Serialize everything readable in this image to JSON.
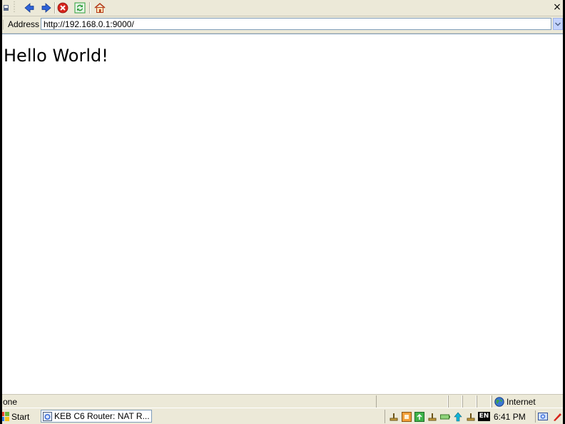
{
  "toolbar": {
    "icons": [
      "back-icon",
      "forward-icon",
      "stop-icon",
      "refresh-icon",
      "home-icon"
    ],
    "close_label": "×"
  },
  "address": {
    "label": "Address",
    "url": "http://192.168.0.1:9000/"
  },
  "content": {
    "heading": "Hello World!"
  },
  "statusbar": {
    "text": "one",
    "zone": "Internet"
  },
  "taskbar": {
    "start_label": "Start",
    "window_title": "KEB C6 Router: NAT R...",
    "language": "EN",
    "clock": "6:41 PM"
  },
  "colors": {
    "chrome": "#ece9d8",
    "address_border": "#7f9db9",
    "nav_blue": "#2f63d8",
    "stop_red": "#d6241b",
    "refresh_green": "#2e9e3a"
  }
}
